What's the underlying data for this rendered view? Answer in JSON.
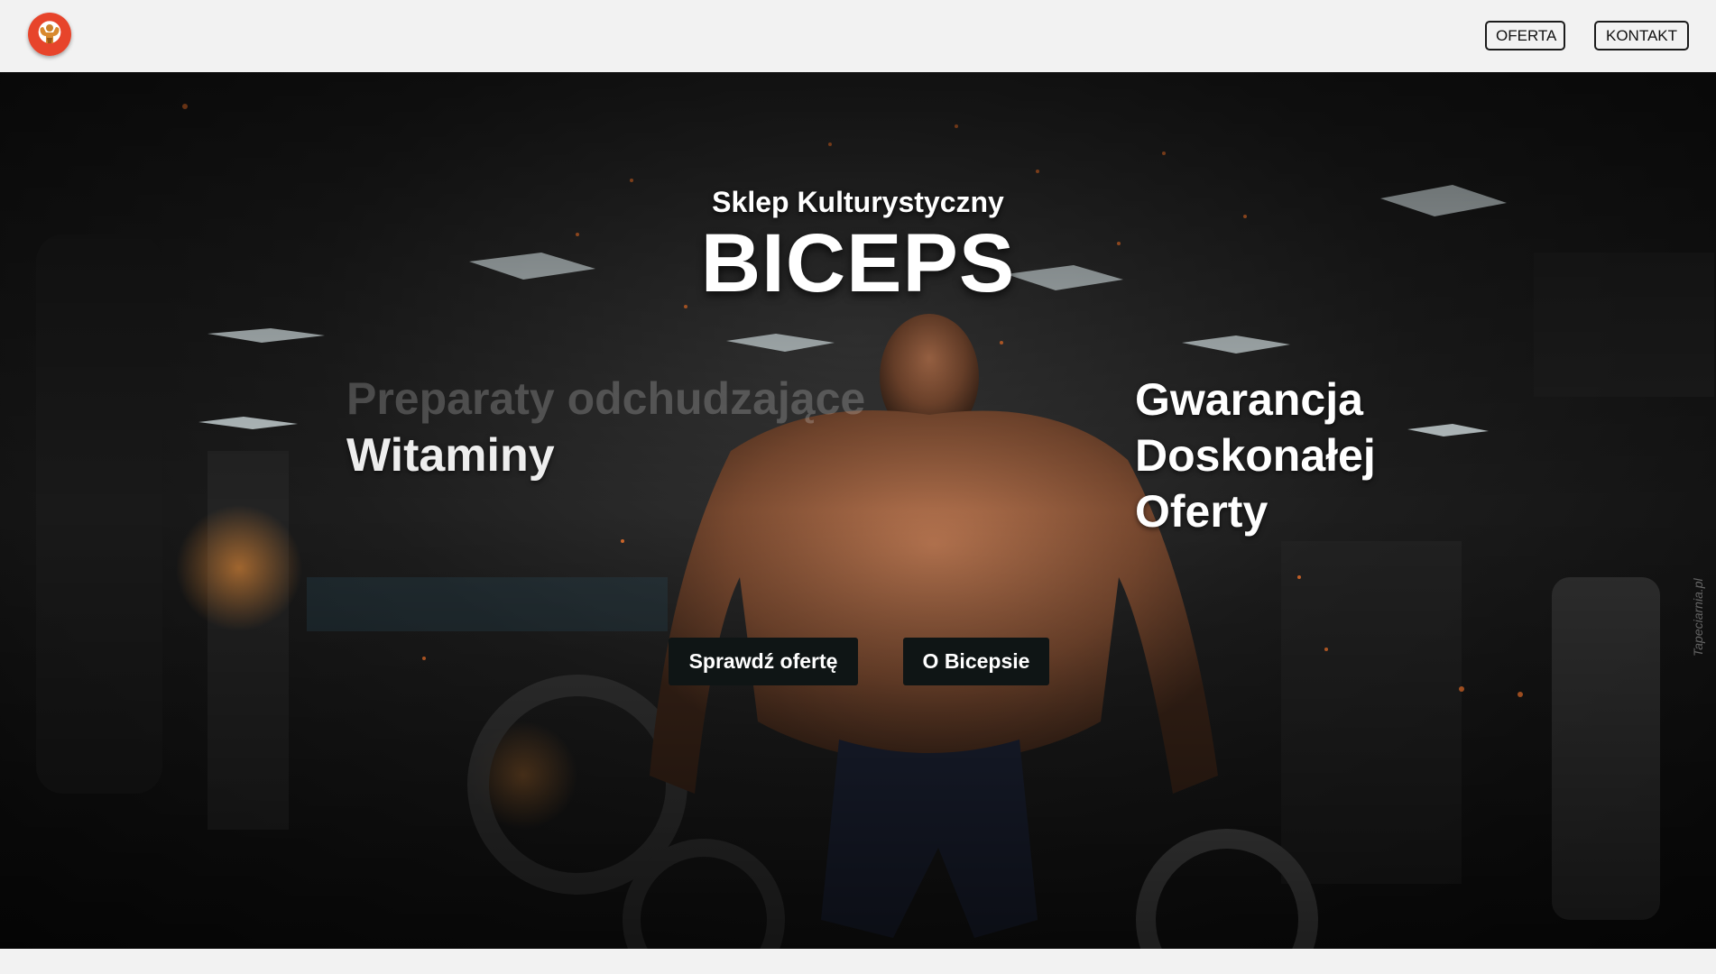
{
  "header": {
    "logo_icon": "bodybuilder-logo-icon",
    "nav": [
      {
        "label": "OFERTA"
      },
      {
        "label": "KONTAKT"
      }
    ]
  },
  "hero": {
    "subtitle": "Sklep Kulturystyczny",
    "title": "BICEPS",
    "left_faded": "Preparaty odchudzające",
    "left_main": "Witaminy",
    "right_lines": [
      "Gwarancja",
      "Doskonałej",
      "Oferty"
    ],
    "buttons": [
      {
        "label": "Sprawdź ofertę"
      },
      {
        "label": "O Bicepsie"
      }
    ],
    "watermark": "Tapeciarnia.pl"
  },
  "colors": {
    "page_bg": "#f2f2f2",
    "hero_dark": "#1d1d1d",
    "button_bg": "#0f1515",
    "logo_red": "#e7442b"
  }
}
